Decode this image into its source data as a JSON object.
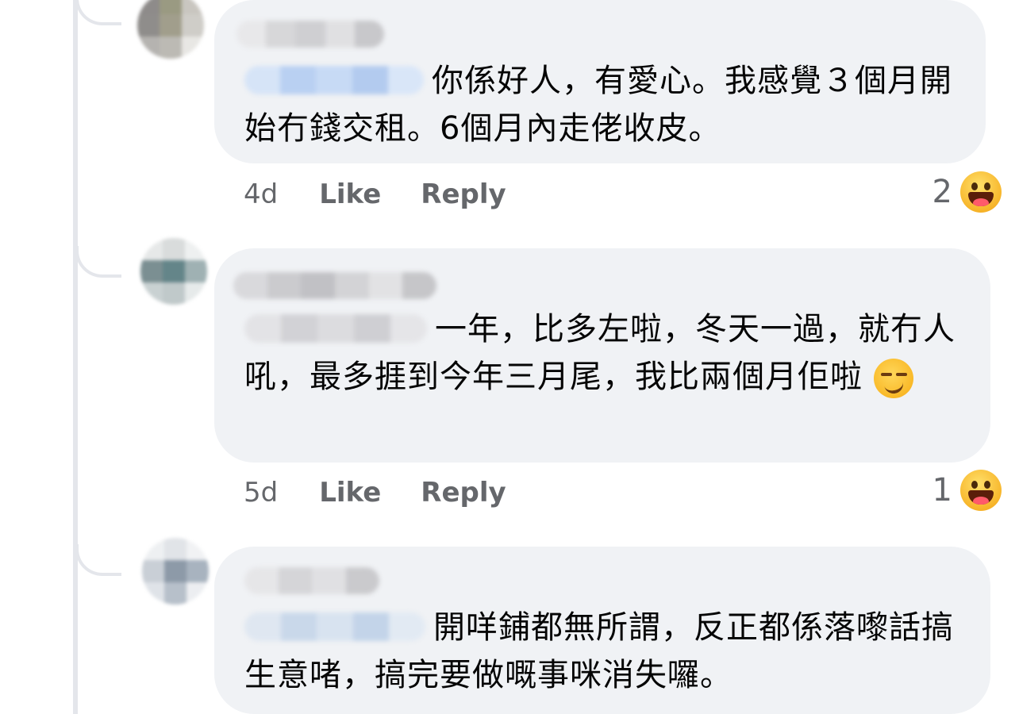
{
  "comments": [
    {
      "text": "你係好人，有愛心。我感覺３個月開始冇錢交租。6個月內走佬收皮。",
      "time": "4d",
      "like_label": "Like",
      "reply_label": "Reply",
      "reaction_count": "2",
      "reaction_icon": "haha-emoji-icon"
    },
    {
      "text": "一年，比多左啦，冬天一過，就冇人吼，最多捱到今年三月尾，我比兩個月佢啦",
      "inline_emoji": "smirking-face-icon",
      "time": "5d",
      "like_label": "Like",
      "reply_label": "Reply",
      "reaction_count": "1",
      "reaction_icon": "haha-emoji-icon"
    },
    {
      "text": "開咩鋪都無所謂，反正都係落嚟話搞生意啫，搞完要做嘅事咪消失囉。"
    }
  ],
  "colors": {
    "bubble": "#f0f2f5",
    "text": "#050505",
    "meta": "#65676b",
    "thread_line": "#e4e6eb"
  }
}
